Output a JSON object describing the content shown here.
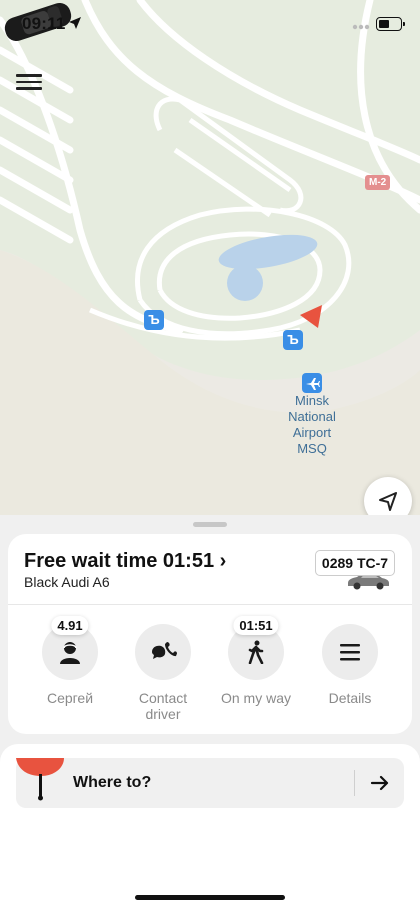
{
  "status_bar": {
    "time": "09:11",
    "battery_fraction": 0.5
  },
  "map": {
    "road_label": "M-2",
    "airport_name": [
      "Minsk",
      "National",
      "Airport",
      "MSQ"
    ],
    "bus_stop_glyph": "Ъ"
  },
  "ride": {
    "title": "Free wait time 01:51 ›",
    "car": "Black Audi A6",
    "plate": "0289 ТС-7"
  },
  "actions": [
    {
      "label": "Сергей",
      "badge": "4.91",
      "icon": "driver-avatar-icon"
    },
    {
      "label": "Contact\ndriver",
      "badge": "",
      "icon": "phone-chat-icon"
    },
    {
      "label": "On my way",
      "badge": "01:51",
      "icon": "walking-person-icon"
    },
    {
      "label": "Details",
      "badge": "",
      "icon": "menu-lines-icon"
    }
  ],
  "search": {
    "placeholder": "Where to?"
  },
  "colors": {
    "accent_pin": "#e8533f",
    "map_blue": "#3a8ee6"
  }
}
